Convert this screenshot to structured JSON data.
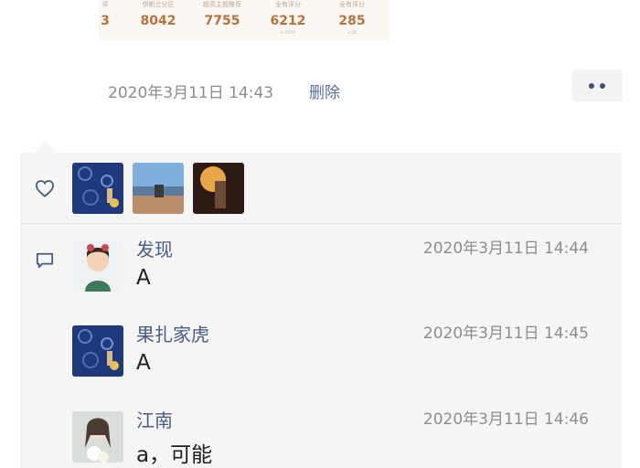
{
  "stats": [
    {
      "label": "评",
      "value": "3",
      "sub": ""
    },
    {
      "label": "伊斯兰分区",
      "value": "8042",
      "sub": ""
    },
    {
      "label": "超高主题推荐",
      "value": "7755",
      "sub": ""
    },
    {
      "label": "全有评分",
      "value": "6212",
      "sub": "+1500"
    },
    {
      "label": "全有评分",
      "value": "285",
      "sub": "+35"
    }
  ],
  "post": {
    "timestamp": "2020年3月11日 14:43",
    "delete_label": "删除"
  },
  "icons": {
    "like": "heart-icon",
    "comment": "comment-icon",
    "more": "more-dots-icon"
  },
  "colors": {
    "name_link": "#4a5b82",
    "delete_link": "#5c6e94",
    "panel_bg": "#f5f5f5",
    "meta_gray": "#8d8d8d",
    "stat_value": "#b9723c"
  },
  "comments": [
    {
      "name": "发现",
      "time": "2020年3月11日 14:44",
      "text": "A"
    },
    {
      "name": "果扎家虎",
      "time": "2020年3月11日 14:45",
      "text": "A"
    },
    {
      "name": "江南",
      "time": "2020年3月11日 14:46",
      "text": "a，可能"
    }
  ]
}
